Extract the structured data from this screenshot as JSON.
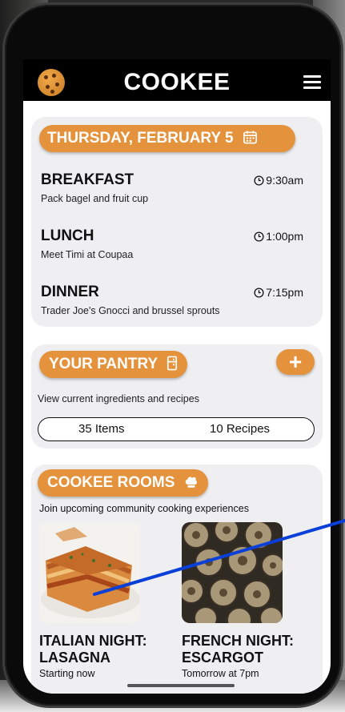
{
  "app": {
    "title": "COOKEE"
  },
  "colors": {
    "accent": "#e4923b",
    "card_bg": "#efeff1",
    "pointer_line": "#0a3fd8"
  },
  "icons": {
    "logo": "cookie-icon",
    "menu": "hamburger-menu-icon",
    "date": "calendar-icon",
    "time": "clock-icon",
    "pantry": "pantry-icon",
    "add": "plus-icon",
    "rooms": "chef-hat-icon"
  },
  "schedule": {
    "date_label": "THURSDAY, FEBRUARY 5",
    "meals": [
      {
        "name": "BREAKFAST",
        "time": "9:30am",
        "desc": "Pack bagel and fruit cup"
      },
      {
        "name": "LUNCH",
        "time": "1:00pm",
        "desc": "Meet Timi at Coupaa"
      },
      {
        "name": "DINNER",
        "time": "7:15pm",
        "desc": "Trader Joe's Gnocci and brussel sprouts"
      }
    ]
  },
  "pantry": {
    "title": "YOUR PANTRY",
    "add_label": "+",
    "desc": "View current ingredients and recipes",
    "items": "35 Items",
    "recipes": "10 Recipes"
  },
  "rooms": {
    "title": "COOKEE ROOMS",
    "desc": "Join upcoming community cooking experiences",
    "events": [
      {
        "title": "ITALIAN NIGHT: LASAGNA",
        "sub": "Starting now"
      },
      {
        "title": "FRENCH NIGHT: ESCARGOT",
        "sub": "Tomorrow at 7pm"
      }
    ]
  }
}
